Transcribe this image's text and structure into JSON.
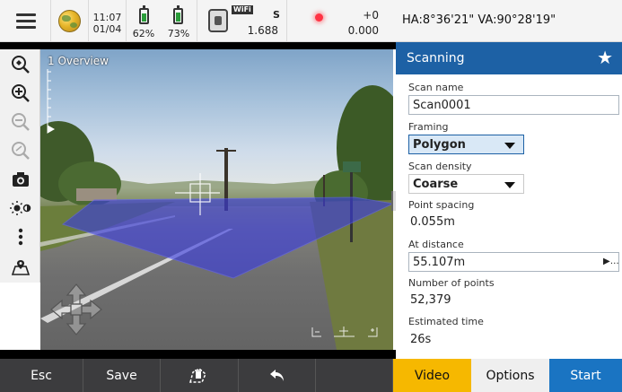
{
  "statusbar": {
    "time": "11:07",
    "date": "01/04",
    "battery_1_percent": "62%",
    "battery_1_level": 0.62,
    "battery_2_percent": "73%",
    "battery_2_level": 0.73,
    "wifi_label": "WiFi",
    "instrument_mode": "S",
    "instrument_distance": "1.688",
    "target_offset": "+0",
    "target_height": "0.000",
    "angles": "HA:8°36'21\"  VA:90°28'19\"",
    "icons": [
      "menu-icon",
      "globe-icon",
      "battery-icon",
      "battery-icon",
      "instrument-icon",
      "target-icon"
    ]
  },
  "tools": [
    "zoom-extents-icon",
    "zoom-in-icon",
    "zoom-out-icon",
    "zoom-previous-icon",
    "camera-icon",
    "brightness-icon",
    "more-icon",
    "survey-point-icon"
  ],
  "view": {
    "overlay_label": "1 Overview"
  },
  "panel": {
    "title": "Scanning",
    "scan_name_label": "Scan name",
    "scan_name_value": "Scan0001",
    "framing_label": "Framing",
    "framing_value": "Polygon",
    "scan_density_label": "Scan density",
    "scan_density_value": "Coarse",
    "point_spacing_label": "Point spacing",
    "point_spacing_value": "0.055m",
    "at_distance_label": "At distance",
    "at_distance_value": "55.107m",
    "number_of_points_label": "Number of points",
    "number_of_points_value": "52,379",
    "estimated_time_label": "Estimated time",
    "estimated_time_value": "26s"
  },
  "bottombar": {
    "esc_label": "Esc",
    "save_label": "Save",
    "video_label": "Video",
    "options_label": "Options",
    "start_label": "Start"
  },
  "colors": {
    "accent_blue": "#1d61a5",
    "start_blue": "#1a74c2",
    "video_yellow": "#f6b800",
    "scan_polygon": "#3a3ce0",
    "bottombar": "#3c3c3e"
  }
}
